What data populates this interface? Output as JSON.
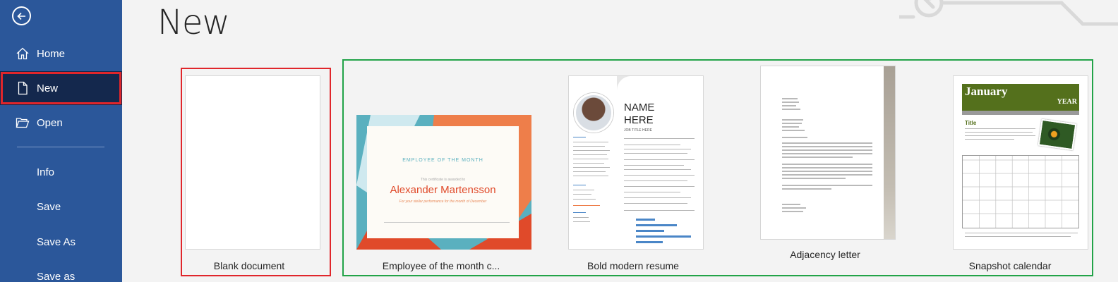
{
  "sidebar": {
    "back_icon": "back-arrow-icon",
    "items": [
      {
        "label": "Home",
        "icon": "home-icon"
      },
      {
        "label": "New",
        "icon": "new-document-icon"
      },
      {
        "label": "Open",
        "icon": "open-folder-icon"
      },
      {
        "label": "Info"
      },
      {
        "label": "Save"
      },
      {
        "label": "Save As"
      },
      {
        "label": "Save as"
      }
    ],
    "active_item": "New",
    "bg_color": "#2b579a",
    "active_bg_color": "#14284d"
  },
  "main": {
    "title": "New",
    "templates": [
      {
        "caption": "Blank document"
      },
      {
        "caption": "Employee of the month c...",
        "preview": {
          "heading": "EMPLOYEE OF THE MONTH",
          "subheading": "This certificate is awarded to",
          "name": "Alexander Martensson",
          "note": "For your stellar performance for the month of December"
        }
      },
      {
        "caption": "Bold modern resume",
        "preview": {
          "name_line1": "NAME",
          "name_line2": "HERE",
          "job_title": "JOB TITLE HERE"
        }
      },
      {
        "caption": "Adjacency letter"
      },
      {
        "caption": "Snapshot calendar",
        "preview": {
          "month": "January",
          "year": "YEAR",
          "title": "Title"
        }
      }
    ]
  },
  "highlights": {
    "red": "#e0262b",
    "green": "#22a348"
  }
}
